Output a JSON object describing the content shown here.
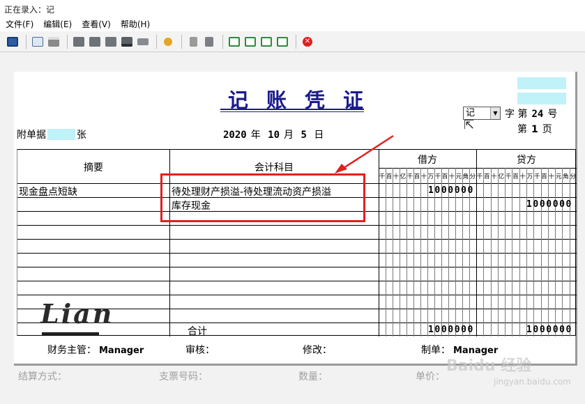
{
  "window": {
    "title": "正在录入：记"
  },
  "menu": [
    "文件(F)",
    "编辑(E)",
    "查看(V)",
    "帮助(H)"
  ],
  "toolbar": {
    "icons": [
      "save-icon",
      "preview-icon",
      "print-icon",
      "copy-icon",
      "paste-icon",
      "book-icon",
      "tape-icon",
      "folder-icon",
      "wizard-icon",
      "calculator-icon",
      "stamp-icon",
      "first-icon",
      "prev-icon",
      "next-icon",
      "last-icon",
      "close-icon"
    ]
  },
  "voucher": {
    "title": "记账凭证",
    "word_select": "记",
    "ref": {
      "zi": "字",
      "di": "第",
      "number": "24",
      "hao": "号"
    },
    "page": {
      "di": "第",
      "number": "1",
      "ye": "页"
    },
    "attachments": {
      "label": "附单据",
      "value": "",
      "unit": "张"
    },
    "date": {
      "year": "2020",
      "year_unit": "年",
      "month": "10",
      "month_unit": "月",
      "day": "5",
      "day_unit": "日"
    },
    "headers": {
      "summary": "摘要",
      "account": "会计科目",
      "debit": "借方",
      "credit": "贷方",
      "units": [
        "千",
        "百",
        "十",
        "亿",
        "千",
        "百",
        "十",
        "万",
        "千",
        "百",
        "十",
        "元",
        "角",
        "分"
      ]
    },
    "rows": [
      {
        "summary": "现金盘点短缺",
        "account": "待处理财产损溢-待处理流动资产损溢",
        "debit": "1000000",
        "credit": ""
      },
      {
        "summary": "",
        "account": "库存现金",
        "debit": "",
        "credit": "1000000"
      }
    ],
    "total": {
      "label": "合计",
      "debit": "1000000",
      "credit": "1000000"
    },
    "signatures": {
      "supervisor_label": "财务主管：",
      "supervisor": "Manager",
      "review_label": "审核：",
      "modify_label": "修改：",
      "maker_label": "制单：",
      "maker": "Manager"
    }
  },
  "footer": {
    "settlement": "结算方式：",
    "check_no": "支票号码：",
    "quantity": "数量：",
    "unit_price": "单价："
  },
  "overlay": {
    "logo_text": "Lian",
    "watermark": "Baidu 经验",
    "watermark_url": "jingyan.baidu.com"
  }
}
